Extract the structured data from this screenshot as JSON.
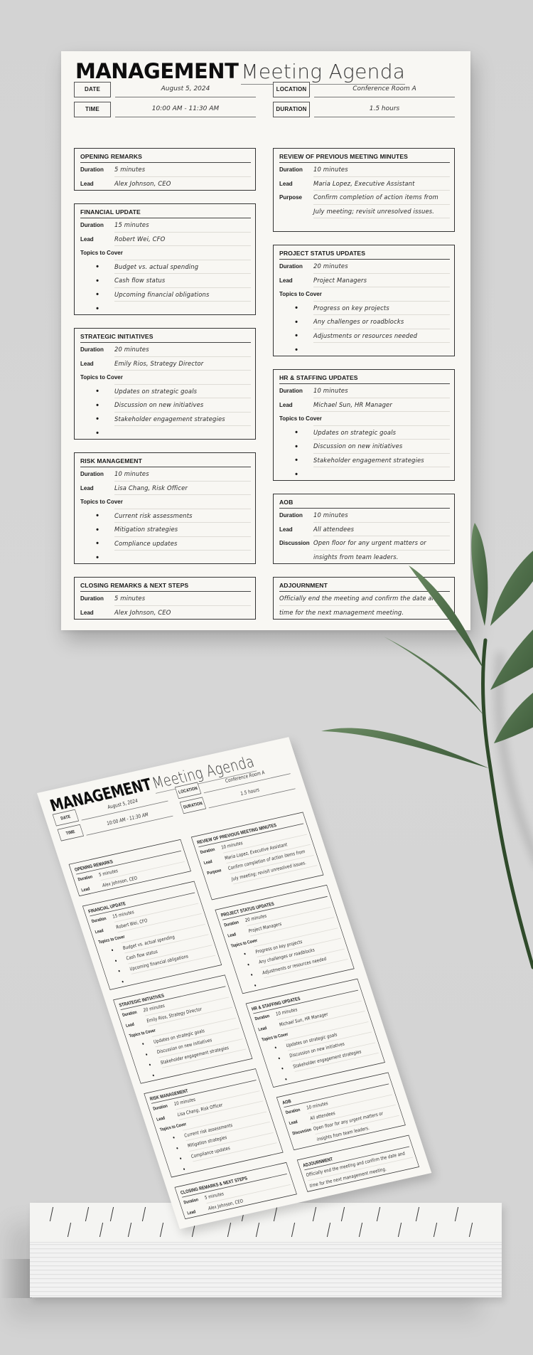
{
  "agenda": {
    "title_bold": "MANAGEMENT",
    "title_light": "Meeting Agenda",
    "meta": {
      "date_label": "DATE",
      "date_value": "August 5, 2024",
      "time_label": "TIME",
      "time_value": "10:00 AM - 11:30 AM",
      "location_label": "LOCATION",
      "location_value": "Conference Room A",
      "duration_label": "DURATION",
      "duration_value": "1.5 hours"
    },
    "labels": {
      "duration": "Duration",
      "lead": "Lead",
      "purpose": "Purpose",
      "discussion": "Discussion",
      "topics": "Topics to Cover"
    },
    "sections": {
      "opening": {
        "title": "OPENING REMARKS",
        "duration": "5 minutes",
        "lead": "Alex Johnson, CEO"
      },
      "financial": {
        "title": "FINANCIAL UPDATE",
        "duration": "15 minutes",
        "lead": "Robert Wei, CFO",
        "topics": [
          "Budget vs. actual spending",
          "Cash flow status",
          "Upcoming financial obligations",
          ""
        ]
      },
      "strategic": {
        "title": "STRATEGIC INITIATIVES",
        "duration": "20 minutes",
        "lead": "Emily Rios, Strategy Director",
        "topics": [
          "Updates on strategic goals",
          "Discussion on new initiatives",
          "Stakeholder engagement strategies",
          ""
        ]
      },
      "risk": {
        "title": "RISK MANAGEMENT",
        "duration": "10 minutes",
        "lead": "Lisa Chang, Risk Officer",
        "topics": [
          "Current risk assessments",
          "Mitigation strategies",
          "Compliance updates",
          ""
        ]
      },
      "closing": {
        "title": "CLOSING REMARKS & NEXT STEPS",
        "duration": "5 minutes",
        "lead": "Alex Johnson, CEO"
      },
      "review": {
        "title": "REVIEW OF PREVIOUS MEETING MINUTES",
        "duration": "10 minutes",
        "lead": "Maria Lopez, Executive Assistant",
        "purpose_lines": [
          "Confirm completion of action items from",
          "July meeting; revisit unresolved issues."
        ]
      },
      "project": {
        "title": "PROJECT STATUS UPDATES",
        "duration": "20 minutes",
        "lead": "Project Managers",
        "topics": [
          "Progress on key projects",
          "Any challenges or roadblocks",
          "Adjustments or resources needed",
          ""
        ]
      },
      "hr": {
        "title": "HR & STAFFING UPDATES",
        "duration": "10 minutes",
        "lead": "Michael Sun, HR Manager",
        "topics": [
          "Updates on strategic goals",
          "Discussion on new initiatives",
          "Stakeholder engagement strategies",
          ""
        ]
      },
      "aob": {
        "title": "AOB",
        "duration": "10 minutes",
        "lead": "All attendees",
        "discussion_lines": [
          "Open floor for any urgent matters or",
          "insights from team leaders."
        ]
      },
      "adjournment": {
        "title": "ADJOURNMENT",
        "lines": [
          "Officially end the meeting and confirm the date and",
          "time for the next management meeting."
        ]
      }
    }
  },
  "scene": {
    "background_color": "#d4d4d4",
    "paper_color": "#f8f7f3",
    "leaf_color": "#4f6e4a",
    "stem_color": "#2f4a2a",
    "objects": [
      "agenda-sheet-front",
      "agenda-sheet-tilted",
      "olive-branch",
      "paper-stack"
    ]
  }
}
